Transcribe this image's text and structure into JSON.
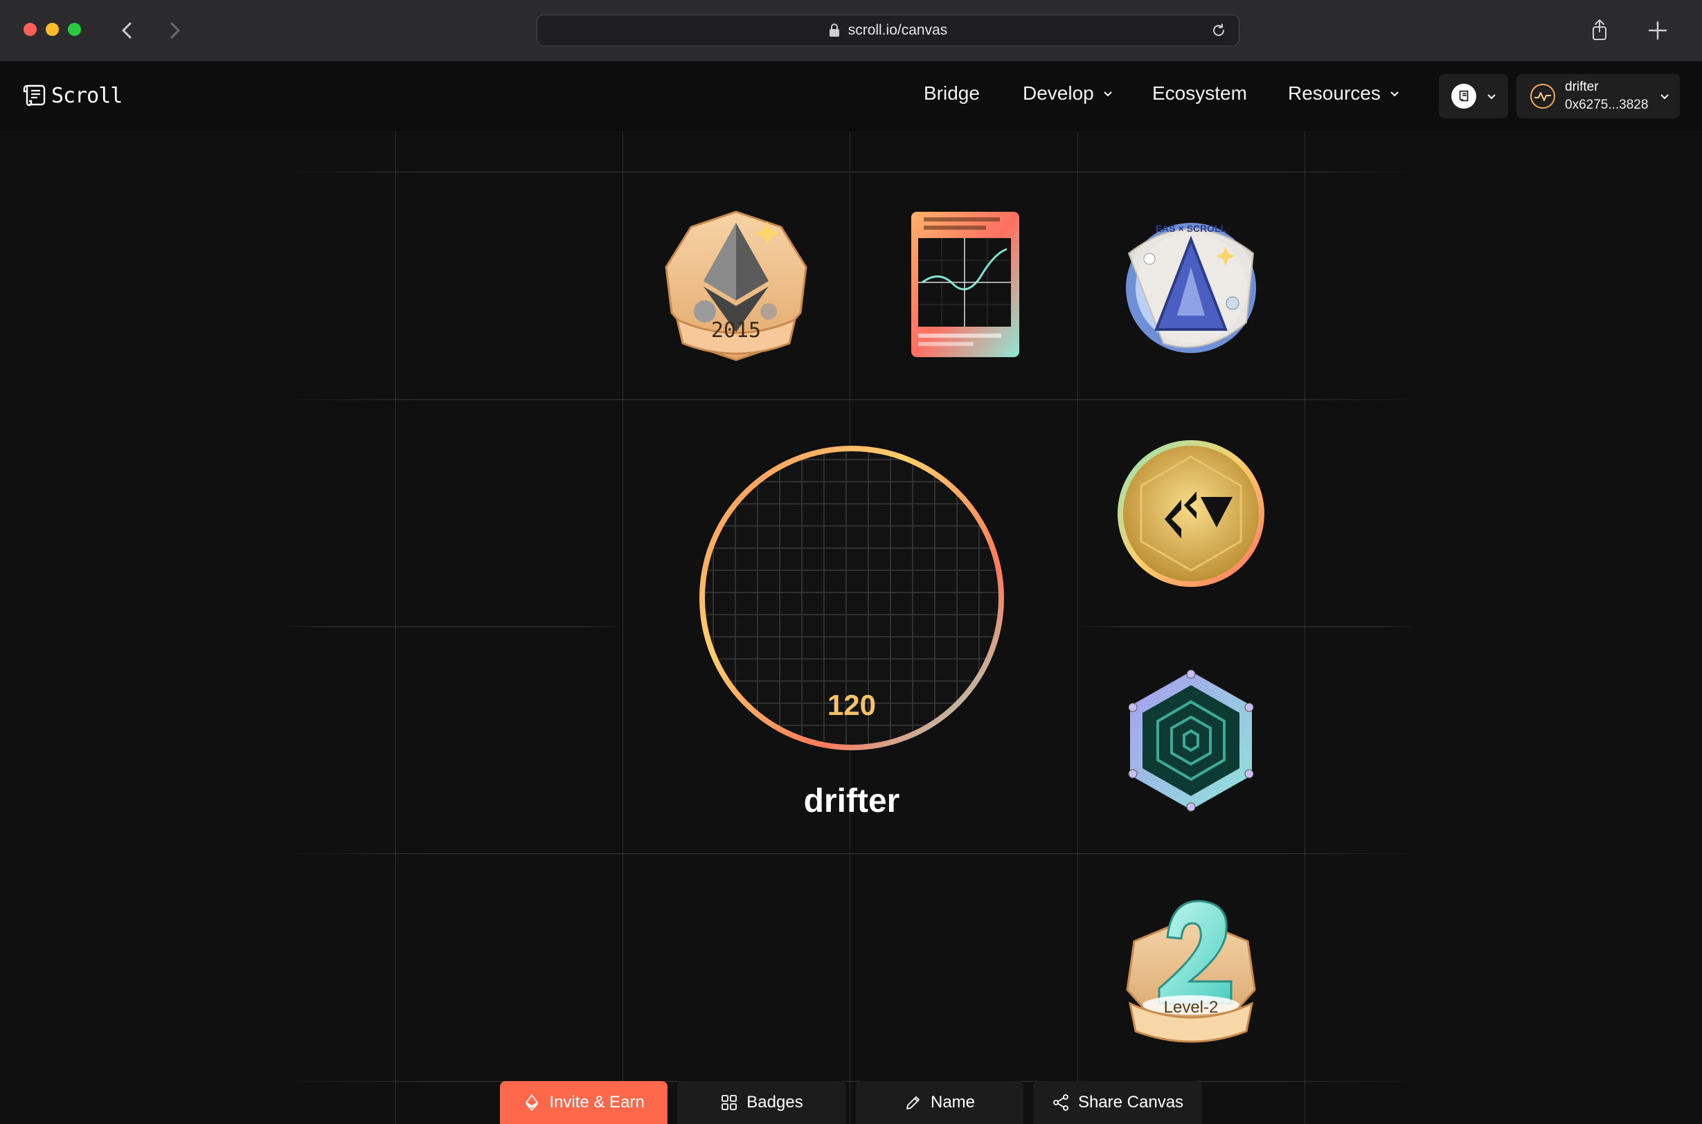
{
  "browser": {
    "url": "scroll.io/canvas"
  },
  "header": {
    "brand": "Scroll",
    "nav": [
      {
        "label": "Bridge"
      },
      {
        "label": "Develop"
      },
      {
        "label": "Ecosystem"
      },
      {
        "label": "Resources"
      }
    ],
    "wallet": {
      "name": "drifter",
      "address": "0x6275...3828"
    }
  },
  "canvas": {
    "username": "drifter",
    "score": "120",
    "badges": [
      {
        "name": "ethereum-2015-badge",
        "label": "2015"
      },
      {
        "name": "equation-scroll-badge",
        "label": ""
      },
      {
        "name": "eas-scroll-badge",
        "label": "EAS × SCROLL"
      },
      {
        "name": "gold-medallion-badge",
        "label": ""
      },
      {
        "name": "hexagon-spiral-badge",
        "label": ""
      },
      {
        "name": "level-2-badge",
        "label": "Level-2"
      }
    ]
  },
  "toolbar": {
    "invite_label": "Invite & Earn",
    "badges_label": "Badges",
    "name_label": "Name",
    "share_label": "Share Canvas"
  },
  "colors": {
    "accent": "#ff684b",
    "background": "#101010",
    "score": "#f6c36a"
  }
}
